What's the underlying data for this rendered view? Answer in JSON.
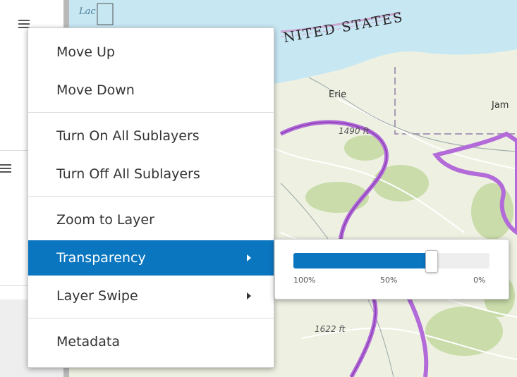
{
  "map": {
    "water_color": "#c7e7f3",
    "land_color": "#eef1e2",
    "green_color": "#c9dcaa",
    "outline_color": "#b26bd8",
    "labels": {
      "country": "NITED STATES",
      "lake_fragment": "Lac",
      "city_erie": "Erie",
      "city_jam": "Jam",
      "elevation_1": "1490 ft",
      "elevation_2": "1622 ft"
    }
  },
  "context_menu": {
    "items": [
      {
        "label": "Move Up",
        "has_submenu": false,
        "active": false
      },
      {
        "label": "Move Down",
        "has_submenu": false,
        "active": false
      },
      {
        "label": "Turn On All Sublayers",
        "has_submenu": false,
        "active": false
      },
      {
        "label": "Turn Off All Sublayers",
        "has_submenu": false,
        "active": false
      },
      {
        "label": "Zoom to Layer",
        "has_submenu": false,
        "active": false
      },
      {
        "label": "Transparency",
        "has_submenu": true,
        "active": true
      },
      {
        "label": "Layer Swipe",
        "has_submenu": true,
        "active": false
      },
      {
        "label": "Metadata",
        "has_submenu": false,
        "active": false
      }
    ],
    "active_color": "#0a76c0"
  },
  "transparency": {
    "value_percent": 70,
    "ticks": [
      "100%",
      "50%",
      "0%"
    ],
    "fill_color": "#0a76c0"
  },
  "icons": {
    "layer_options_1": "hamburger-icon",
    "layer_options_2": "hamburger-icon",
    "submenu": "chevron-right-icon"
  }
}
